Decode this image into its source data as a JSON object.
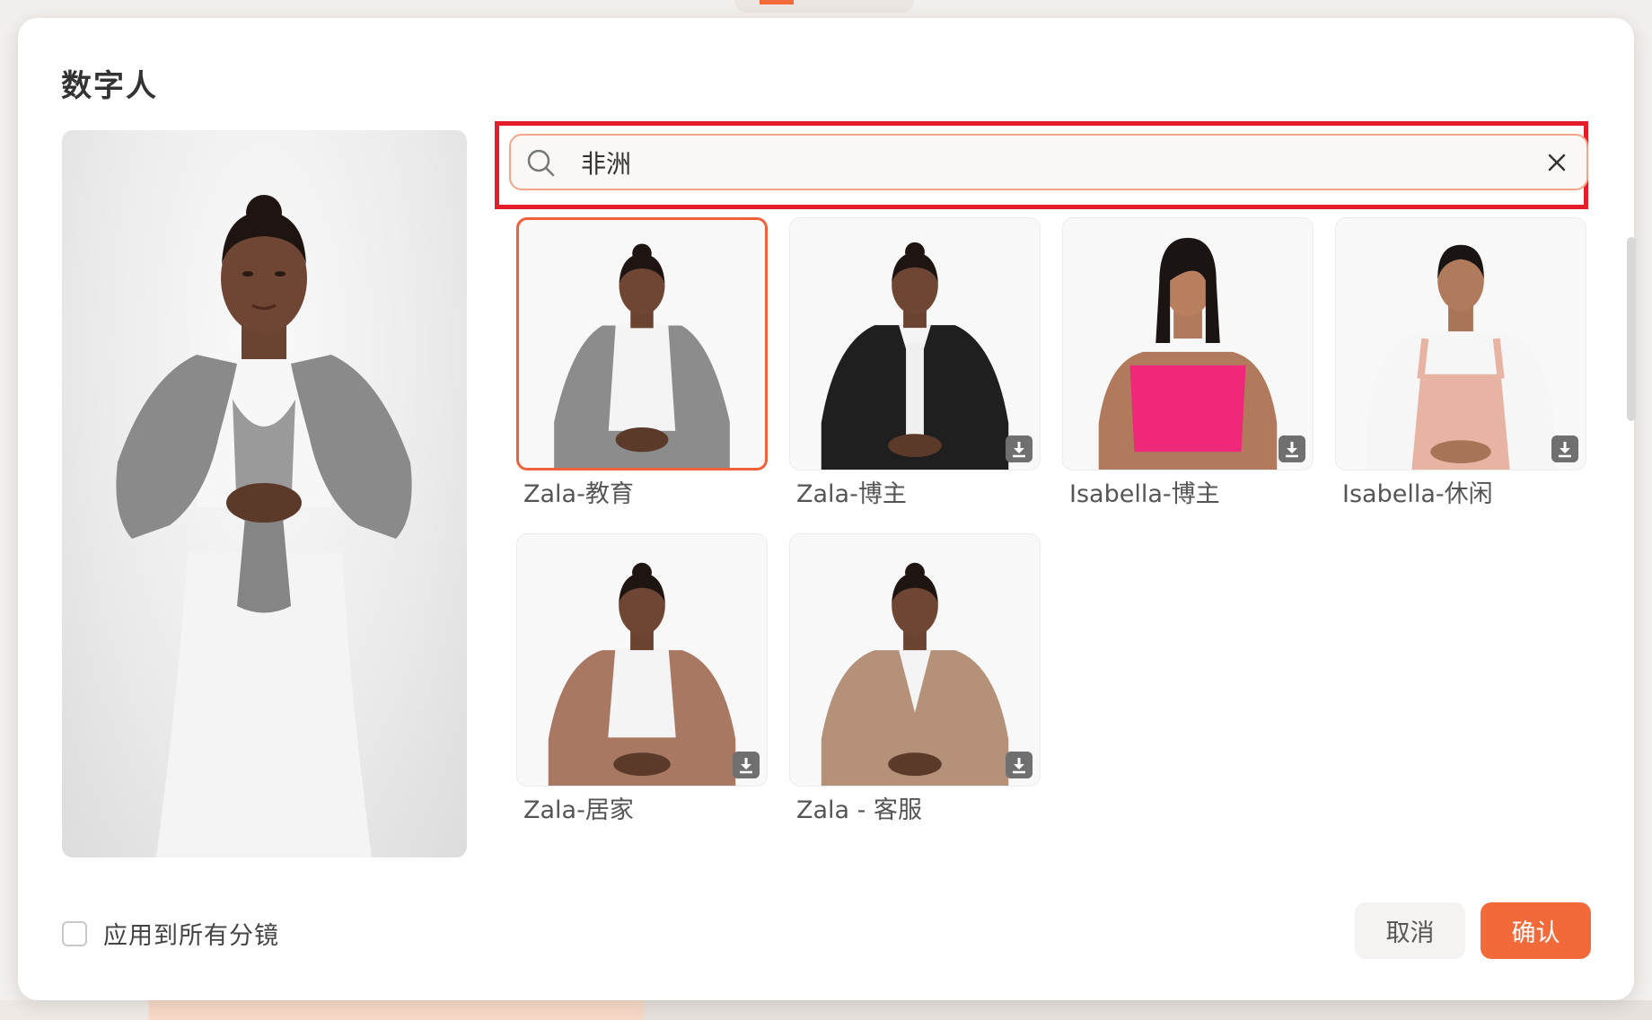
{
  "dialog": {
    "title": "数字人",
    "search": {
      "value": "非洲",
      "placeholder": ""
    },
    "apply_all_label": "应用到所有分镜",
    "apply_all_checked": false,
    "cancel_label": "取消",
    "confirm_label": "确认"
  },
  "avatars": [
    {
      "label": "Zala-教育",
      "selected": true,
      "downloadable": false,
      "outfit": "grey-cardigan"
    },
    {
      "label": "Zala-博主",
      "selected": false,
      "downloadable": true,
      "outfit": "black-blazer"
    },
    {
      "label": "Isabella-博主",
      "selected": false,
      "downloadable": true,
      "outfit": "pink-top"
    },
    {
      "label": "Isabella-休闲",
      "selected": false,
      "downloadable": true,
      "outfit": "pink-overalls"
    },
    {
      "label": "Zala-居家",
      "selected": false,
      "downloadable": true,
      "outfit": "brown-shirt"
    },
    {
      "label": "Zala - 客服",
      "selected": false,
      "downloadable": true,
      "outfit": "tan-blazer"
    }
  ],
  "colors": {
    "accent": "#f36a3a",
    "highlight": "#e41e28",
    "selected_border": "#f0603a"
  },
  "icons": {
    "search": "search-icon",
    "clear": "close-icon",
    "download": "download-icon"
  }
}
